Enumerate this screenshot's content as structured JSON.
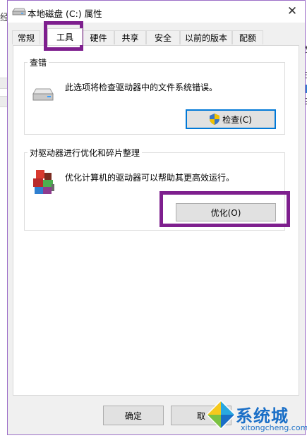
{
  "background": {
    "left_char": "经",
    "right_chars": [
      "衣",
      "E",
      "G"
    ]
  },
  "window": {
    "title": "本地磁盘 (C:) 属性",
    "close_glyph": "✕"
  },
  "tabs": [
    {
      "label": "常规",
      "active": false
    },
    {
      "label": "工具",
      "active": true
    },
    {
      "label": "硬件",
      "active": false
    },
    {
      "label": "共享",
      "active": false
    },
    {
      "label": "安全",
      "active": false
    },
    {
      "label": "以前的版本",
      "active": false
    },
    {
      "label": "配额",
      "active": false
    }
  ],
  "error_check": {
    "group_label": "查错",
    "description": "此选项将检查驱动器中的文件系统错误。",
    "button_label": "检查(C)",
    "icon": "drive-icon"
  },
  "optimize": {
    "group_label": "对驱动器进行优化和碎片整理",
    "description": "优化计算机的驱动器可以帮助其更高效运行。",
    "button_label": "优化(O)",
    "icon": "defrag-icon"
  },
  "footer": {
    "ok_label": "确定",
    "cancel_label": "取"
  },
  "watermark": {
    "title": "系统城",
    "url": "xitongcheng.com"
  },
  "colors": {
    "highlight": "#7e1f8e",
    "accent": "#0078d7",
    "watermark": "#1a6fc7"
  }
}
